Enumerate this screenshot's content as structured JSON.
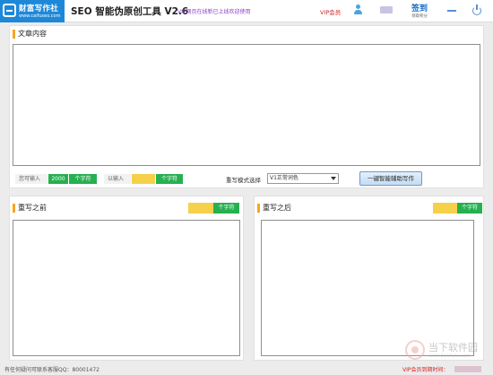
{
  "titlebar": {
    "logo_name": "财富写作社",
    "logo_site": "www.caifuseo.com",
    "app_title": "SEO 智能伪原创工具 V2.6",
    "notice": "VIP网页在线新已上线欢迎使用",
    "vip_link": "VIP会员",
    "checkin_label": "签到",
    "checkin_sub": "领取积分"
  },
  "content": {
    "title": "文章内容",
    "body": "",
    "can_input_label": "您可输入",
    "can_input_value": "2000",
    "can_input_unit": "个字符",
    "already_input_label": "以输入",
    "already_input_value": "",
    "already_input_unit": "个字符",
    "mode_label": "重写模式选择",
    "mode_selected": "V1正常词色",
    "assist_button": "一键智能辅助写作"
  },
  "before": {
    "title": "重写之前",
    "counter_value": "",
    "counter_unit": "个字符",
    "body": ""
  },
  "after": {
    "title": "重写之后",
    "counter_value": "",
    "counter_unit": "个字符",
    "body": ""
  },
  "status": {
    "contact": "有任何疑问可联系客服QQ：80001472",
    "expiry": "VIP会员到期时间："
  },
  "watermark": {
    "text": "当下软件园",
    "url": "www.downxia.com"
  },
  "colors": {
    "accent_blue": "#1e88d8",
    "accent_orange": "#f5a623",
    "counter_green": "#26b050",
    "counter_yellow": "#f7d04a",
    "vip_red": "#d21f1f"
  },
  "icons": [
    "logo-icon",
    "user-icon",
    "minimize-icon",
    "power-icon",
    "dropdown-arrow-icon",
    "watermark-logo-icon"
  ]
}
